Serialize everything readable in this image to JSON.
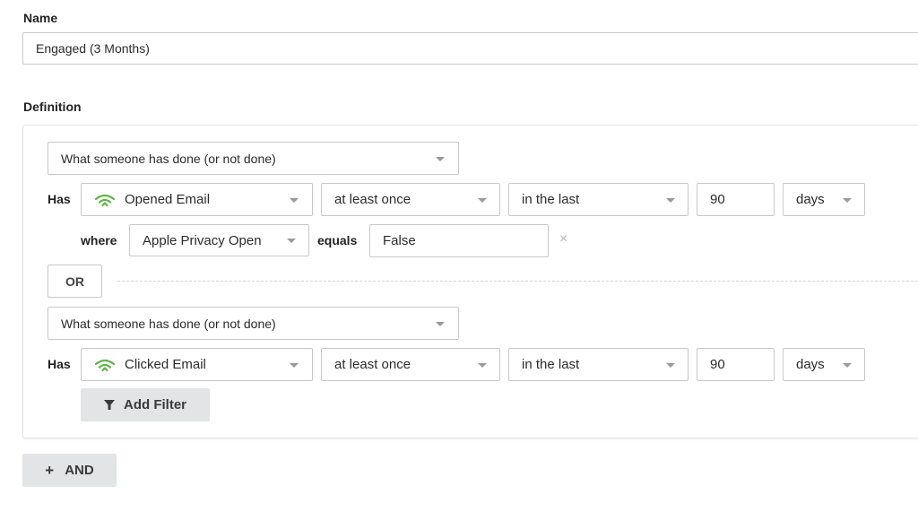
{
  "name_section": {
    "label": "Name",
    "value": "Engaged (3 Months)"
  },
  "definition": {
    "label": "Definition",
    "groups": [
      {
        "condition_type": "What someone has done (or not done)",
        "has_label": "Has",
        "metric": "Opened Email",
        "frequency": "at least once",
        "timeframe": "in the last",
        "amount": "90",
        "unit": "days",
        "filter": {
          "where_label": "where",
          "property": "Apple Privacy Open",
          "operator": "equals",
          "value": "False",
          "remove_icon": "×"
        }
      },
      {
        "condition_type": "What someone has done (or not done)",
        "has_label": "Has",
        "metric": "Clicked Email",
        "frequency": "at least once",
        "timeframe": "in the last",
        "amount": "90",
        "unit": "days",
        "add_filter_label": "Add Filter"
      }
    ],
    "or_label": "OR",
    "and_button": {
      "icon": "+",
      "label": "AND"
    }
  },
  "colors": {
    "metric_icon": "#5fb548",
    "button_bg": "#e2e4e6"
  }
}
